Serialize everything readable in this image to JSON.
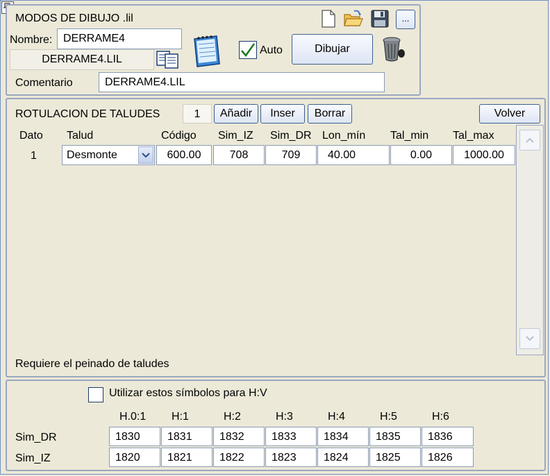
{
  "modes": {
    "title": "MODOS DE DIBUJO .lil",
    "nombre_label": "Nombre:",
    "nombre_value": "DERRAME4",
    "file_value": "DERRAME4.LIL",
    "more_label": "...",
    "auto_label": "Auto",
    "auto_checked": true,
    "dibujar_label": "Dibujar",
    "comentario_label": "Comentario",
    "comentario_value": "DERRAME4.LIL"
  },
  "rotulacion": {
    "title": "ROTULACION DE TALUDES",
    "count": "1",
    "add_label": "Añadir",
    "insert_label": "Inser",
    "delete_label": "Borrar",
    "back_label": "Volver",
    "columns": [
      "Dato",
      "Talud",
      "Código",
      "Sim_IZ",
      "Sim_DR",
      "Lon_mín",
      "Tal_min",
      "Tal_max"
    ],
    "rows": [
      {
        "dato": "1",
        "talud": "Desmonte",
        "codigo": "600.00",
        "sim_iz": "708",
        "sim_dr": "709",
        "lon_min": "40.00",
        "tal_min": "0.00",
        "tal_max": "1000.00"
      }
    ],
    "note": "Requiere el peinado de taludes"
  },
  "symbols": {
    "checkbox_label": "Utilizar estos símbolos para H:V",
    "checked": false,
    "headers": [
      "H.0:1",
      "H:1",
      "H:2",
      "H:3",
      "H:4",
      "H:5",
      "H:6"
    ],
    "rows": [
      {
        "label": "Sim_DR",
        "values": [
          "1830",
          "1831",
          "1832",
          "1833",
          "1834",
          "1835",
          "1836"
        ]
      },
      {
        "label": "Sim_IZ",
        "values": [
          "1820",
          "1821",
          "1822",
          "1823",
          "1824",
          "1825",
          "1826"
        ]
      }
    ]
  }
}
